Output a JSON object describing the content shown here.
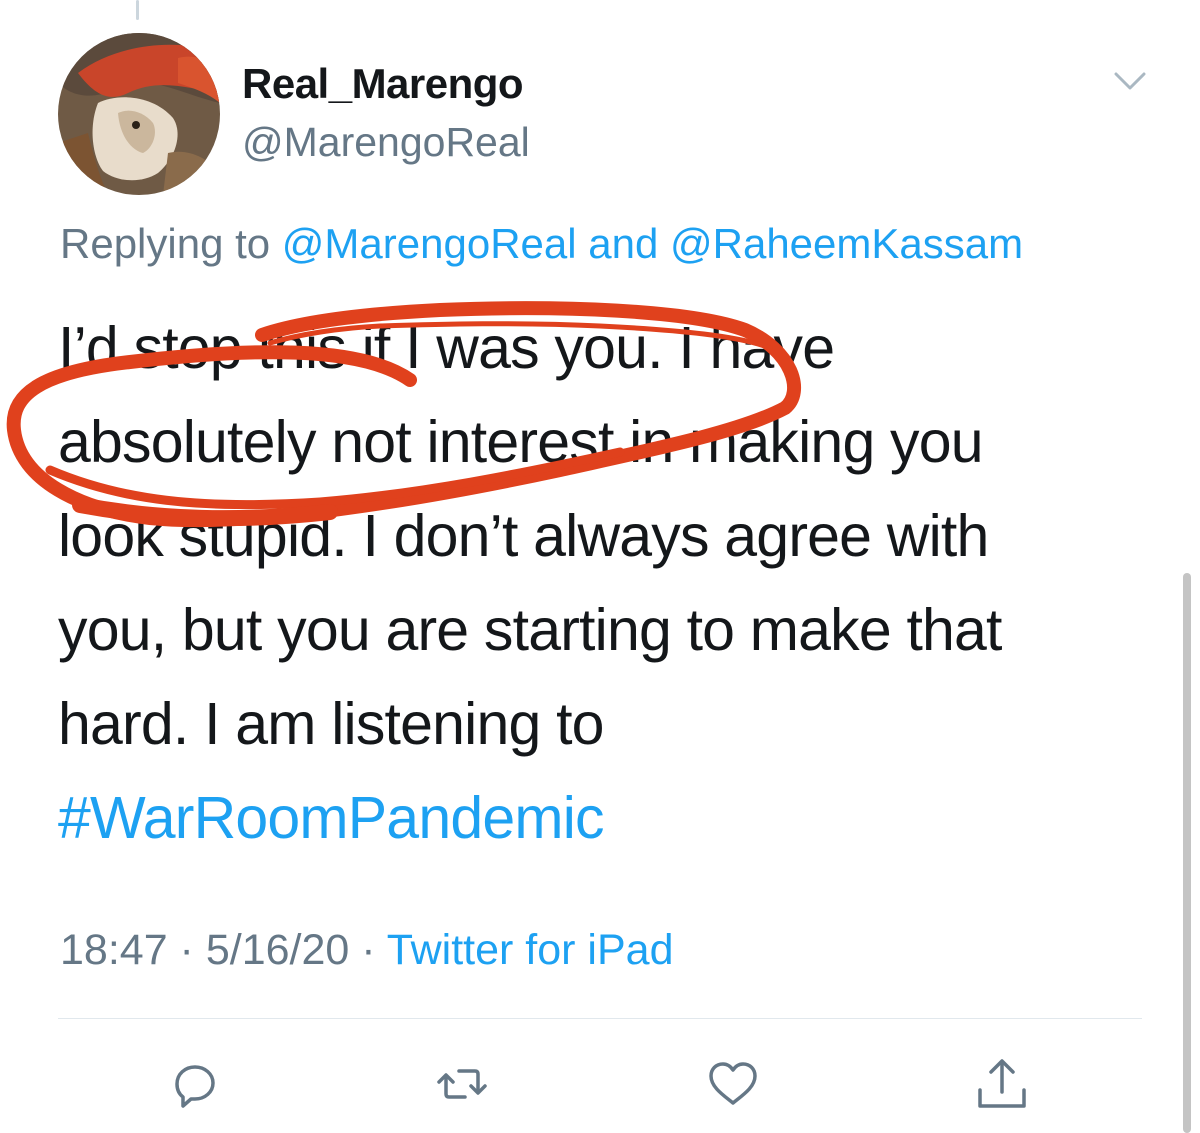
{
  "user": {
    "display_name": "Real_Marengo",
    "handle": "@MarengoReal",
    "avatar_icon": "avatar-icon"
  },
  "reply": {
    "prefix": "Replying to ",
    "mention1": "@MarengoReal",
    "conjunction": " and ",
    "mention2": "@RaheemKassam"
  },
  "tweet": {
    "lines": [
      "I’d stop this if I was you. I have",
      "absolutely not interest in making you",
      "look stupid. I don’t always agree with",
      "you, but you are starting to make that",
      "hard. I am listening to"
    ],
    "hashtag": "#WarRoomPandemic"
  },
  "meta": {
    "time": "18:47",
    "separator1": " · ",
    "date": "5/16/20",
    "separator2": " · ",
    "source": "Twitter for iPad"
  },
  "icons": {
    "menu": "chevron-down-icon",
    "reply": "reply-icon",
    "retweet": "retweet-icon",
    "like": "heart-icon",
    "share": "share-icon"
  },
  "colors": {
    "link": "#1da1f2",
    "secondary_text": "#657786",
    "primary_text": "#14171a",
    "annotation": "#e0411d"
  }
}
